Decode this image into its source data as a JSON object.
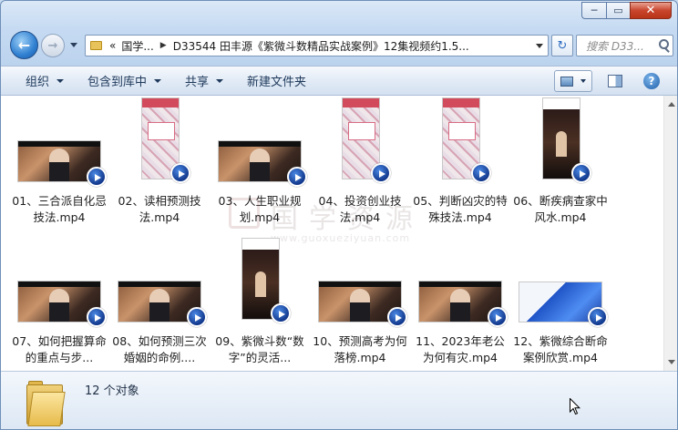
{
  "window": {
    "minimize_label": "─",
    "maximize_label": "▭",
    "close_label": "✕"
  },
  "nav": {
    "back_label": "←",
    "forward_label": "→",
    "address_overflow": "«",
    "address_segments": [
      "国学...",
      "D33544 田丰源《紫微斗数精品实战案例》12集视频约1.5..."
    ],
    "refresh_label": "↻",
    "search_placeholder": "搜索 D33..."
  },
  "commands": {
    "organize": "组织",
    "include_in_library": "包含到库中",
    "share": "共享",
    "new_folder": "新建文件夹",
    "help_label": "?"
  },
  "watermark": {
    "text": "国学资源",
    "url": "www.guoxueziyuan.com"
  },
  "files": [
    {
      "name": "01、三合派自化忌技法.mp4",
      "thumb": "landscape"
    },
    {
      "name": "02、读相预测技法.mp4",
      "thumb": "portrait"
    },
    {
      "name": "03、人生职业规划.mp4",
      "thumb": "landscape"
    },
    {
      "name": "04、投资创业技法.mp4",
      "thumb": "portrait"
    },
    {
      "name": "05、判断凶灾的特殊技法.mp4",
      "thumb": "portrait"
    },
    {
      "name": "06、断疾病查家中风水.mp4",
      "thumb": "stage"
    },
    {
      "name": "07、如何把握算命的重点与步...",
      "thumb": "landscape"
    },
    {
      "name": "08、如何预测三次婚姻的命例....",
      "thumb": "landscape"
    },
    {
      "name": "09、紫微斗数“数字”的灵活...",
      "thumb": "stage"
    },
    {
      "name": "10、预测高考为何落榜.mp4",
      "thumb": "landscape"
    },
    {
      "name": "11、2023年老公为何有灾.mp4",
      "thumb": "landscape"
    },
    {
      "name": "12、紫微综合断命案例欣赏.mp4",
      "thumb": "blue"
    }
  ],
  "status": {
    "item_count": "12 个对象"
  },
  "icons": [
    "folder-icon",
    "search-icon",
    "play-badge-icon",
    "view-icon",
    "preview-pane-icon",
    "help-icon"
  ],
  "colors": {
    "accent": "#2f7fd1",
    "close": "#c9452d",
    "folder": "#e8c25a"
  }
}
